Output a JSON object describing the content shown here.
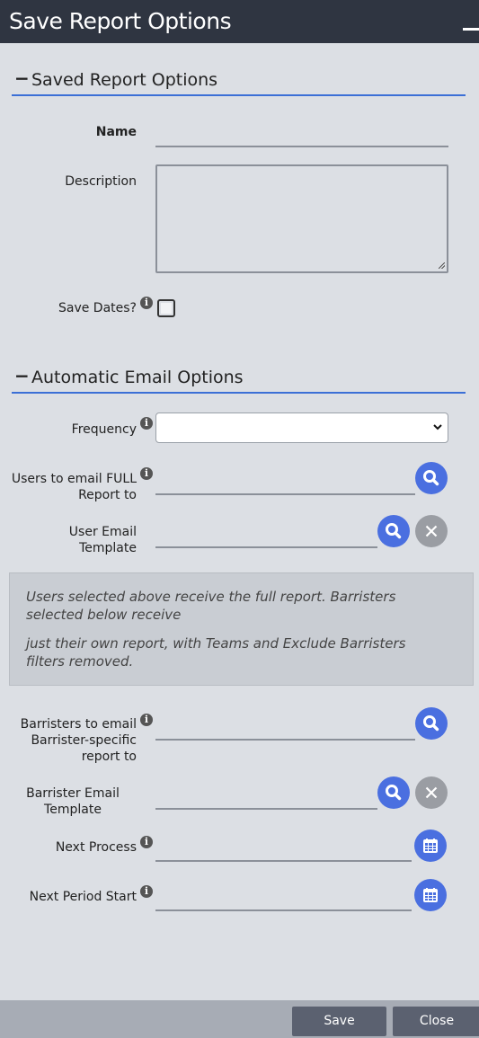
{
  "window": {
    "title": "Save Report Options"
  },
  "saved_section": {
    "toggle": "−",
    "title": "Saved Report Options",
    "name_label": "Name",
    "name_value": "",
    "description_label": "Description",
    "description_value": "",
    "save_dates_label": "Save Dates?",
    "save_dates_checked": false
  },
  "email_section": {
    "toggle": "−",
    "title": "Automatic Email Options",
    "frequency_label": "Frequency",
    "frequency_value": "",
    "users_full_label_1": "Users to email FULL",
    "users_full_label_2": "Report to",
    "users_full_value": "",
    "user_template_label": "User Email Template",
    "user_template_value": ""
  },
  "notice": {
    "line1": "Users selected above receive the full report. Barristers selected below receive",
    "line2": "just their own report, with Teams and Exclude Barristers filters removed."
  },
  "barrister_section": {
    "barristers_label_1": "Barristers to email",
    "barristers_label_2": "Barrister-specific",
    "barristers_label_3": "report to",
    "barristers_value": "",
    "template_label_1": "Barrister Email",
    "template_label_2": "Template",
    "template_value": "",
    "next_process_label": "Next Process",
    "next_process_value": "",
    "next_period_label": "Next Period Start",
    "next_period_value": ""
  },
  "info_glyph": "i",
  "footer": {
    "save_label": "Save",
    "close_label": "Close"
  },
  "colors": {
    "titlebar": "#2f3541",
    "accent": "#3b6fd6",
    "icon_button": "#4a6fe0",
    "clear_button": "#9a9da3",
    "footer_button": "#5b6170"
  },
  "icons": [
    "minimize-icon",
    "collapse-icon",
    "info-icon",
    "search-icon",
    "clear-icon",
    "calendar-icon",
    "chevron-down-icon",
    "resize-grip-icon"
  ]
}
